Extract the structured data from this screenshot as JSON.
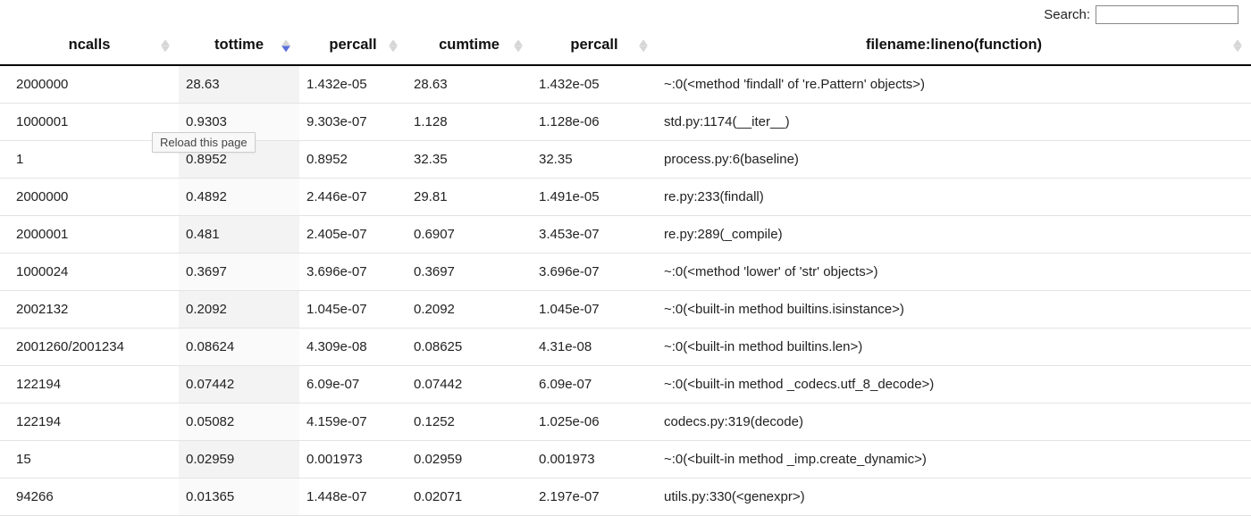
{
  "search": {
    "label": "Search:",
    "value": ""
  },
  "tooltip": "Reload this page",
  "columns": [
    {
      "label": "ncalls",
      "sorted": false
    },
    {
      "label": "tottime",
      "sorted": true
    },
    {
      "label": "percall",
      "sorted": false
    },
    {
      "label": "cumtime",
      "sorted": false
    },
    {
      "label": "percall",
      "sorted": false
    },
    {
      "label": "filename:lineno(function)",
      "sorted": false
    }
  ],
  "rows": [
    {
      "ncalls": "2000000",
      "tottime": "28.63",
      "percall1": "1.432e-05",
      "cumtime": "28.63",
      "percall2": "1.432e-05",
      "filename": "~:0(<method 'findall' of 're.Pattern' objects>)"
    },
    {
      "ncalls": "1000001",
      "tottime": "0.9303",
      "percall1": "9.303e-07",
      "cumtime": "1.128",
      "percall2": "1.128e-06",
      "filename": "std.py:1174(__iter__)"
    },
    {
      "ncalls": "1",
      "tottime": "0.8952",
      "percall1": "0.8952",
      "cumtime": "32.35",
      "percall2": "32.35",
      "filename": "process.py:6(baseline)"
    },
    {
      "ncalls": "2000000",
      "tottime": "0.4892",
      "percall1": "2.446e-07",
      "cumtime": "29.81",
      "percall2": "1.491e-05",
      "filename": "re.py:233(findall)"
    },
    {
      "ncalls": "2000001",
      "tottime": "0.481",
      "percall1": "2.405e-07",
      "cumtime": "0.6907",
      "percall2": "3.453e-07",
      "filename": "re.py:289(_compile)"
    },
    {
      "ncalls": "1000024",
      "tottime": "0.3697",
      "percall1": "3.696e-07",
      "cumtime": "0.3697",
      "percall2": "3.696e-07",
      "filename": "~:0(<method 'lower' of 'str' objects>)"
    },
    {
      "ncalls": "2002132",
      "tottime": "0.2092",
      "percall1": "1.045e-07",
      "cumtime": "0.2092",
      "percall2": "1.045e-07",
      "filename": "~:0(<built-in method builtins.isinstance>)"
    },
    {
      "ncalls": "2001260/2001234",
      "tottime": "0.08624",
      "percall1": "4.309e-08",
      "cumtime": "0.08625",
      "percall2": "4.31e-08",
      "filename": "~:0(<built-in method builtins.len>)"
    },
    {
      "ncalls": "122194",
      "tottime": "0.07442",
      "percall1": "6.09e-07",
      "cumtime": "0.07442",
      "percall2": "6.09e-07",
      "filename": "~:0(<built-in method _codecs.utf_8_decode>)"
    },
    {
      "ncalls": "122194",
      "tottime": "0.05082",
      "percall1": "4.159e-07",
      "cumtime": "0.1252",
      "percall2": "1.025e-06",
      "filename": "codecs.py:319(decode)"
    },
    {
      "ncalls": "15",
      "tottime": "0.02959",
      "percall1": "0.001973",
      "cumtime": "0.02959",
      "percall2": "0.001973",
      "filename": "~:0(<built-in method _imp.create_dynamic>)"
    },
    {
      "ncalls": "94266",
      "tottime": "0.01365",
      "percall1": "1.448e-07",
      "cumtime": "0.02071",
      "percall2": "2.197e-07",
      "filename": "utils.py:330(<genexpr>)"
    }
  ]
}
